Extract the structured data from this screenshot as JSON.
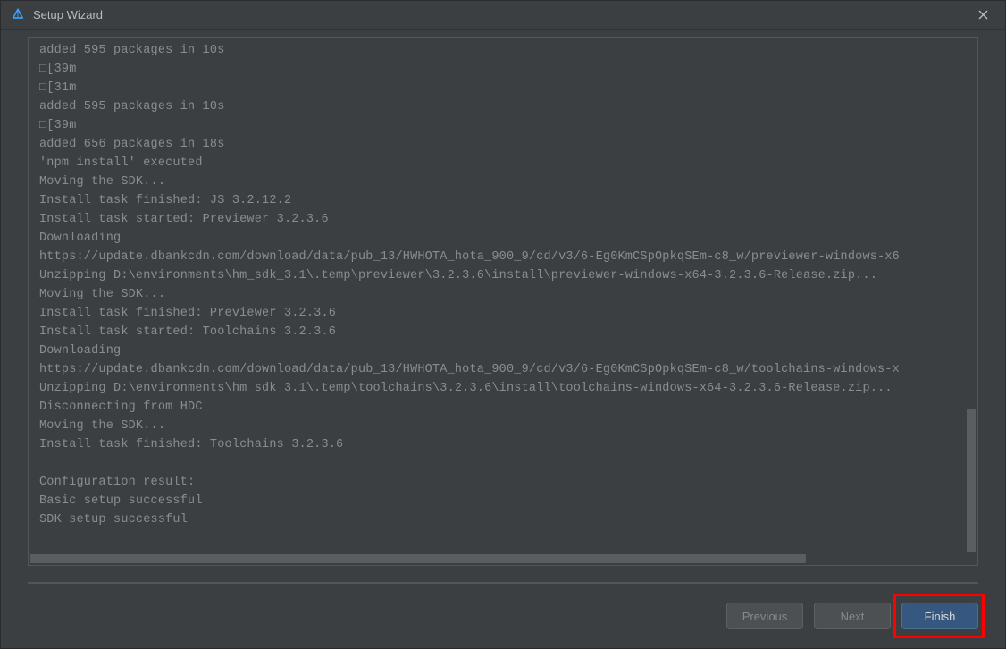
{
  "titlebar": {
    "title": "Setup Wizard"
  },
  "log_lines": [
    "added 595 packages in 10s",
    " □[39m",
    "□[31m",
    "added 595 packages in 10s",
    " □[39m",
    "added 656 packages in 18s",
    "'npm install' executed",
    "Moving the SDK...",
    "Install task finished: JS 3.2.12.2",
    "Install task started: Previewer 3.2.3.6",
    "Downloading",
    "https://update.dbankcdn.com/download/data/pub_13/HWHOTA_hota_900_9/cd/v3/6-Eg0KmCSpOpkqSEm-c8_w/previewer-windows-x6",
    "Unzipping D:\\environments\\hm_sdk_3.1\\.temp\\previewer\\3.2.3.6\\install\\previewer-windows-x64-3.2.3.6-Release.zip...",
    "Moving the SDK...",
    "Install task finished: Previewer 3.2.3.6",
    "Install task started: Toolchains 3.2.3.6",
    "Downloading",
    "https://update.dbankcdn.com/download/data/pub_13/HWHOTA_hota_900_9/cd/v3/6-Eg0KmCSpOpkqSEm-c8_w/toolchains-windows-x",
    "Unzipping D:\\environments\\hm_sdk_3.1\\.temp\\toolchains\\3.2.3.6\\install\\toolchains-windows-x64-3.2.3.6-Release.zip...",
    "Disconnecting from HDC",
    "Moving the SDK...",
    "Install task finished: Toolchains 3.2.3.6",
    "",
    "Configuration result:",
    "Basic setup successful",
    "SDK setup successful"
  ],
  "footer": {
    "previous_label": "Previous",
    "next_label": "Next",
    "finish_label": "Finish"
  }
}
